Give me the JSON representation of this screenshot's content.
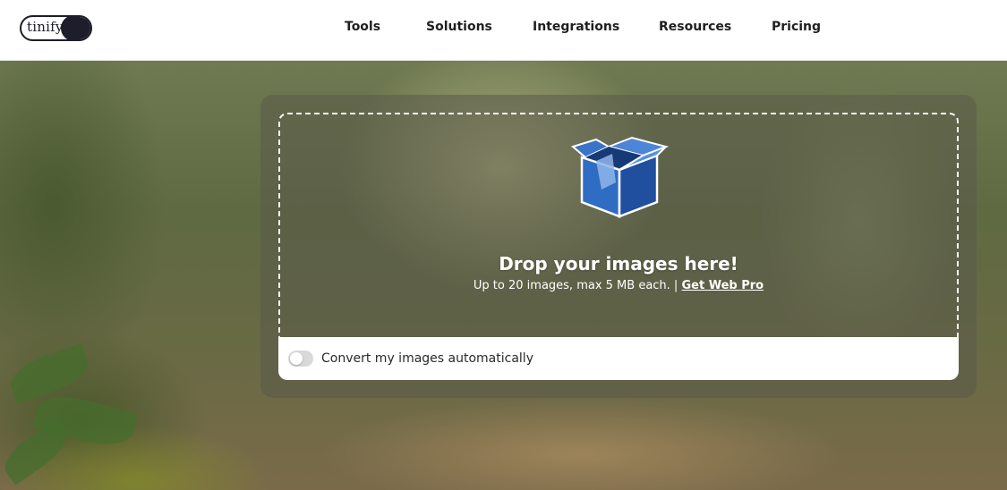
{
  "brand": {
    "logo_text": "tinify"
  },
  "nav": {
    "items": [
      "Tools",
      "Solutions",
      "Integrations",
      "Resources",
      "Pricing"
    ]
  },
  "dropzone": {
    "title": "Drop your images here!",
    "subtitle": "Up to 20 images, max 5 MB each. |",
    "link": "Get Web Pro",
    "icon": "box-icon"
  },
  "convert": {
    "label": "Convert my images automatically",
    "enabled": false
  },
  "colors": {
    "dark": "#1d1d2b",
    "box_blue": "#2a62b8",
    "white": "#ffffff"
  }
}
